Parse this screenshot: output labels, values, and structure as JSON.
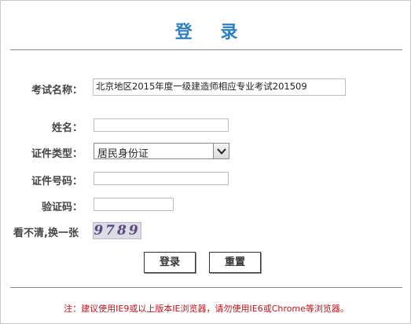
{
  "title": "登  录",
  "form": {
    "exam_name": {
      "label": "考试名称：",
      "value": "北京地区2015年度一级建造师相应专业考试201509"
    },
    "name": {
      "label": "姓名：",
      "value": ""
    },
    "id_type": {
      "label": "证件类型：",
      "selected": "居民身份证"
    },
    "id_number": {
      "label": "证件号码：",
      "value": ""
    },
    "captcha": {
      "label": "验证码：",
      "value": ""
    },
    "refresh": {
      "label": "看不清,换一张",
      "code": "9789"
    }
  },
  "buttons": {
    "login": "登录",
    "reset": "重置"
  },
  "note": "注：建议使用IE9或以上版本IE浏览器，请勿使用IE6或Chrome等浏览器。",
  "colors": {
    "title": "#2e7fbf",
    "note": "#c0131b"
  },
  "icons": {
    "select_arrow": "chevron-down-icon"
  }
}
